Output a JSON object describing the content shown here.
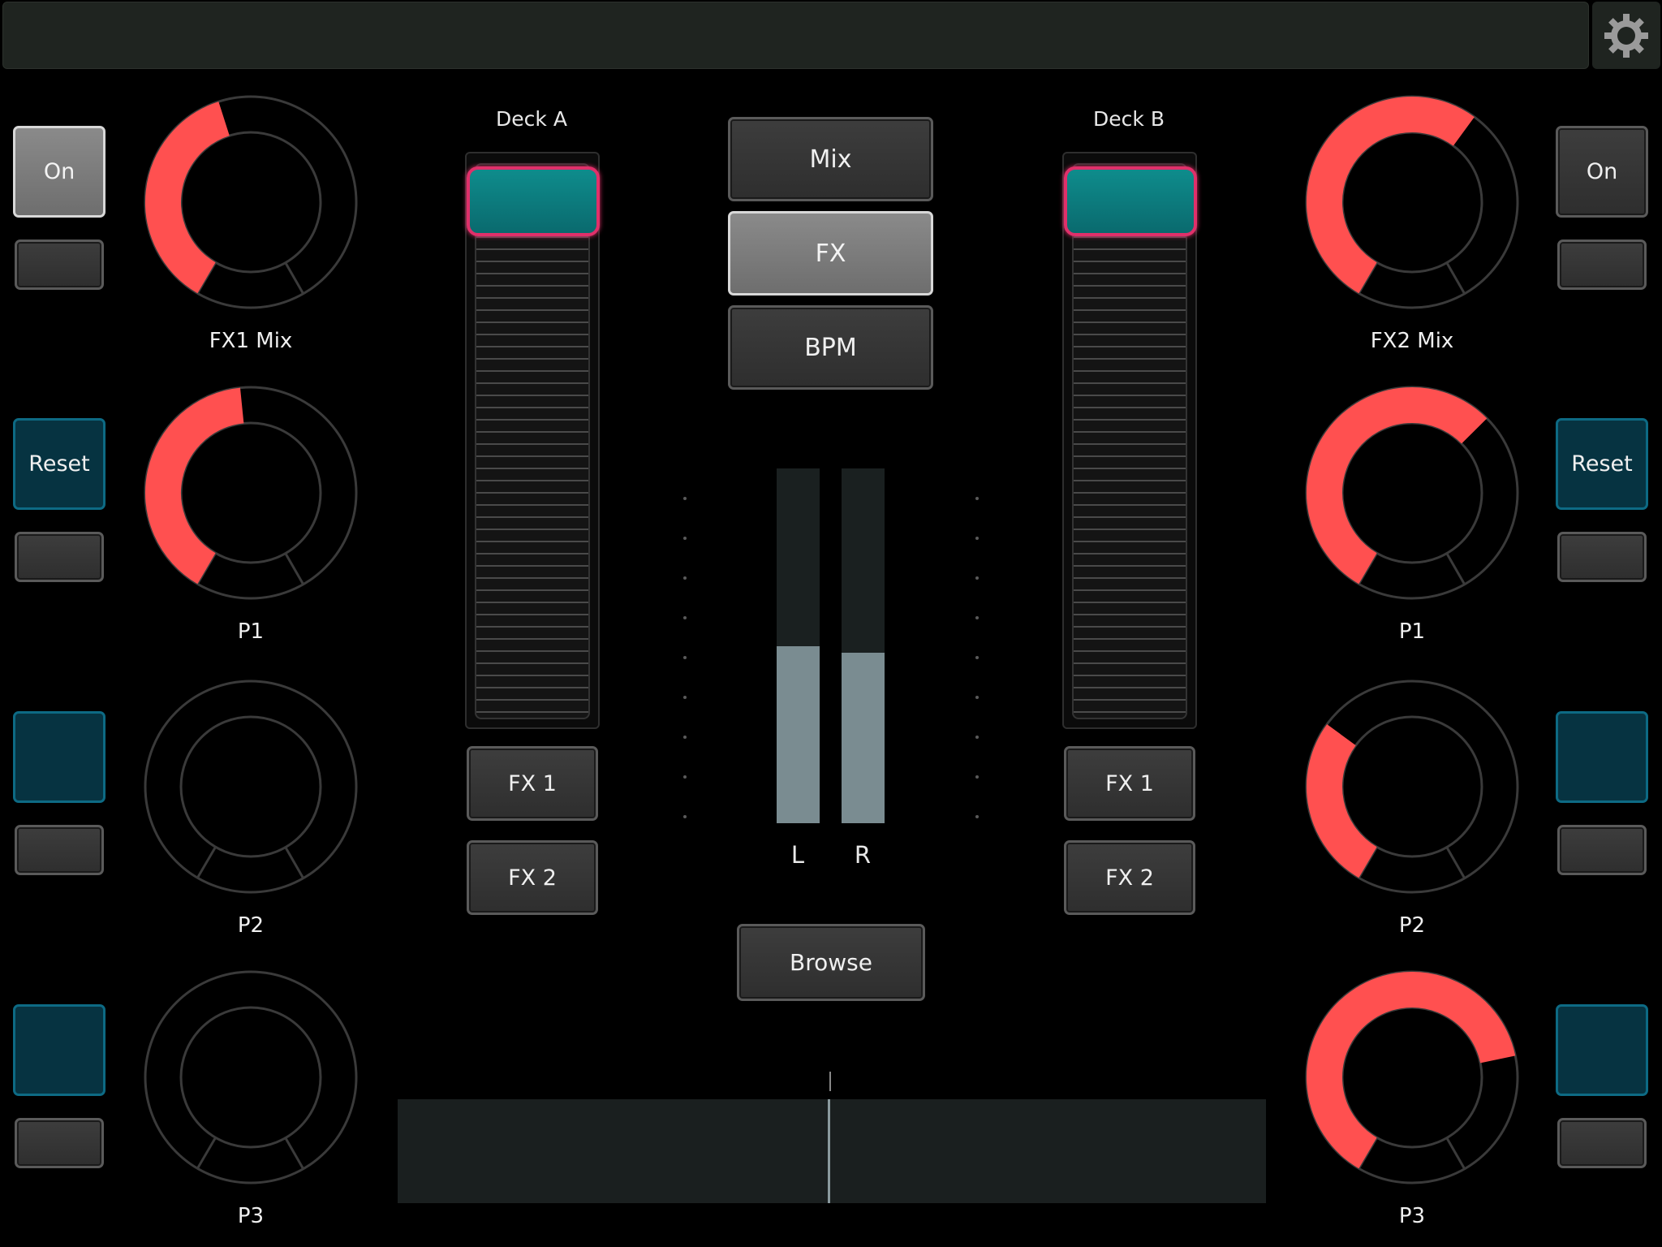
{
  "left": {
    "knobs": [
      {
        "label": "FX1 Mix",
        "value": 0.44
      },
      {
        "label": "P1",
        "value": 0.48
      },
      {
        "label": "P2",
        "value": 0.0
      },
      {
        "label": "P3",
        "value": 0.0
      }
    ],
    "buttons": [
      {
        "label": "On",
        "style": "grey"
      },
      {
        "label": "Reset",
        "style": "teal"
      },
      {
        "label": "",
        "style": "teal"
      },
      {
        "label": "",
        "style": "teal"
      }
    ]
  },
  "right": {
    "knobs": [
      {
        "label": "FX2 Mix",
        "value": 0.62
      },
      {
        "label": "P1",
        "value": 0.65
      },
      {
        "label": "P2",
        "value": 0.32
      },
      {
        "label": "P3",
        "value": 0.76
      }
    ],
    "buttons": [
      {
        "label": "On",
        "style": "dark"
      },
      {
        "label": "Reset",
        "style": "teal"
      },
      {
        "label": "",
        "style": "teal"
      },
      {
        "label": "",
        "style": "teal"
      }
    ]
  },
  "deck_a": {
    "label": "Deck A",
    "fx1": "FX 1",
    "fx2": "FX 2",
    "fader_value": 1.0
  },
  "deck_b": {
    "label": "Deck B",
    "fx1": "FX 1",
    "fx2": "FX 2",
    "fader_value": 1.0
  },
  "center": {
    "mix": "Mix",
    "fx": "FX",
    "bpm": "BPM",
    "browse": "Browse",
    "meter_left_label": "L",
    "meter_right_label": "R",
    "meter_left_level": 0.5,
    "meter_right_level": 0.48
  },
  "colors": {
    "knob_arc": "#ff5050",
    "knob_ring": "#3a3a3a",
    "fader_handle_border": "#e0306a",
    "fader_handle_fill": "#0e8c8c",
    "teal_button": "#063341"
  },
  "icons": {
    "settings": "gear-icon"
  }
}
